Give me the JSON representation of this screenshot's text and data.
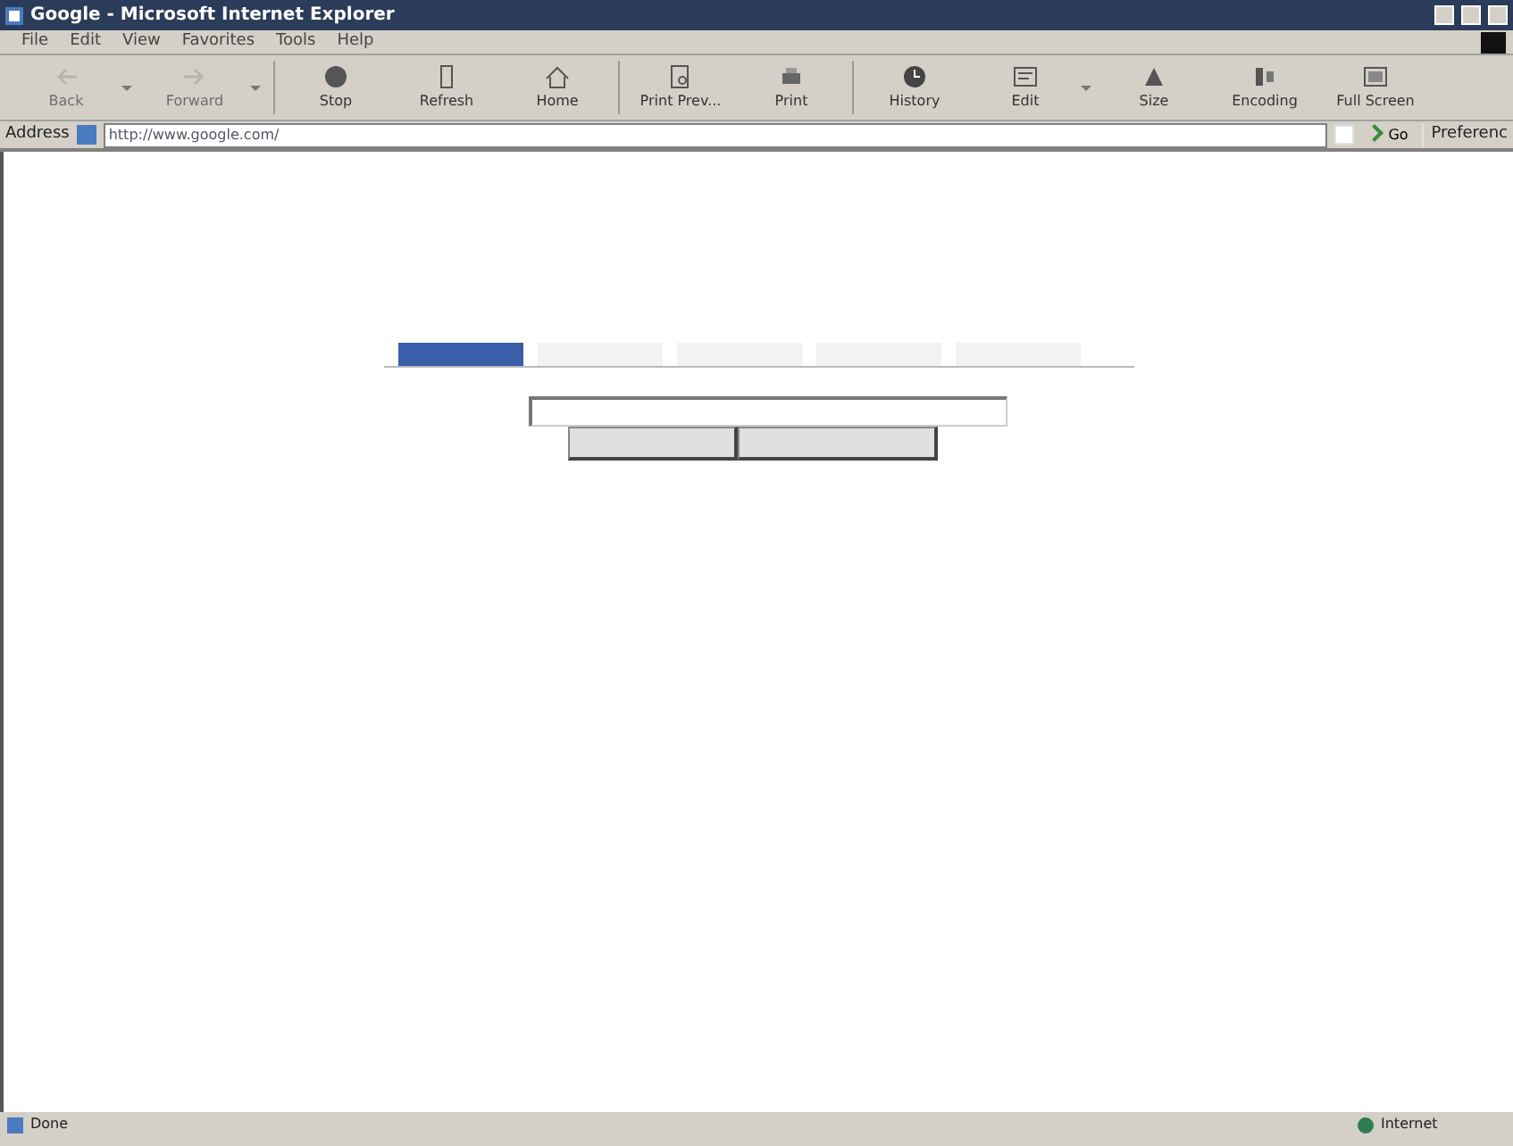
{
  "window": {
    "title": "Google - Microsoft Internet Explorer"
  },
  "menu": [
    "File",
    "Edit",
    "View",
    "Favorites",
    "Tools",
    "Help"
  ],
  "toolbar": [
    {
      "label": "Back",
      "kind": "back",
      "disabled": true,
      "dropdown": true
    },
    {
      "label": "Forward",
      "kind": "forward",
      "disabled": true,
      "dropdown": true
    },
    {
      "label": "Stop",
      "kind": "stop",
      "disabled": false,
      "dropdown": false
    },
    {
      "label": "Refresh",
      "kind": "refresh",
      "disabled": false,
      "dropdown": false
    },
    {
      "label": "Home",
      "kind": "home",
      "disabled": false,
      "dropdown": false
    },
    {
      "label": "Print Prev...",
      "kind": "preview",
      "disabled": false,
      "dropdown": false
    },
    {
      "label": "Print",
      "kind": "print",
      "disabled": false,
      "dropdown": false
    },
    {
      "label": "History",
      "kind": "history",
      "disabled": false,
      "dropdown": false
    },
    {
      "label": "Edit",
      "kind": "edit",
      "disabled": false,
      "dropdown": true
    },
    {
      "label": "Size",
      "kind": "size",
      "disabled": false,
      "dropdown": false
    },
    {
      "label": "Encoding",
      "kind": "encoding",
      "disabled": false,
      "dropdown": false
    },
    {
      "label": "Full Screen",
      "kind": "fullscreen",
      "disabled": false,
      "dropdown": false
    }
  ],
  "address_bar": {
    "label": "Address",
    "value": "http://www.google.com/",
    "go": "Go",
    "extra": "Preferenc"
  },
  "page": {
    "tabs": [
      {
        "selected": true
      },
      {
        "selected": false
      },
      {
        "selected": false
      },
      {
        "selected": false
      },
      {
        "selected": false
      }
    ],
    "buttons": [
      {
        "kind": "button"
      },
      {
        "kind": "button"
      }
    ]
  },
  "status_bar": {
    "text": "Done",
    "zone": "Internet"
  }
}
